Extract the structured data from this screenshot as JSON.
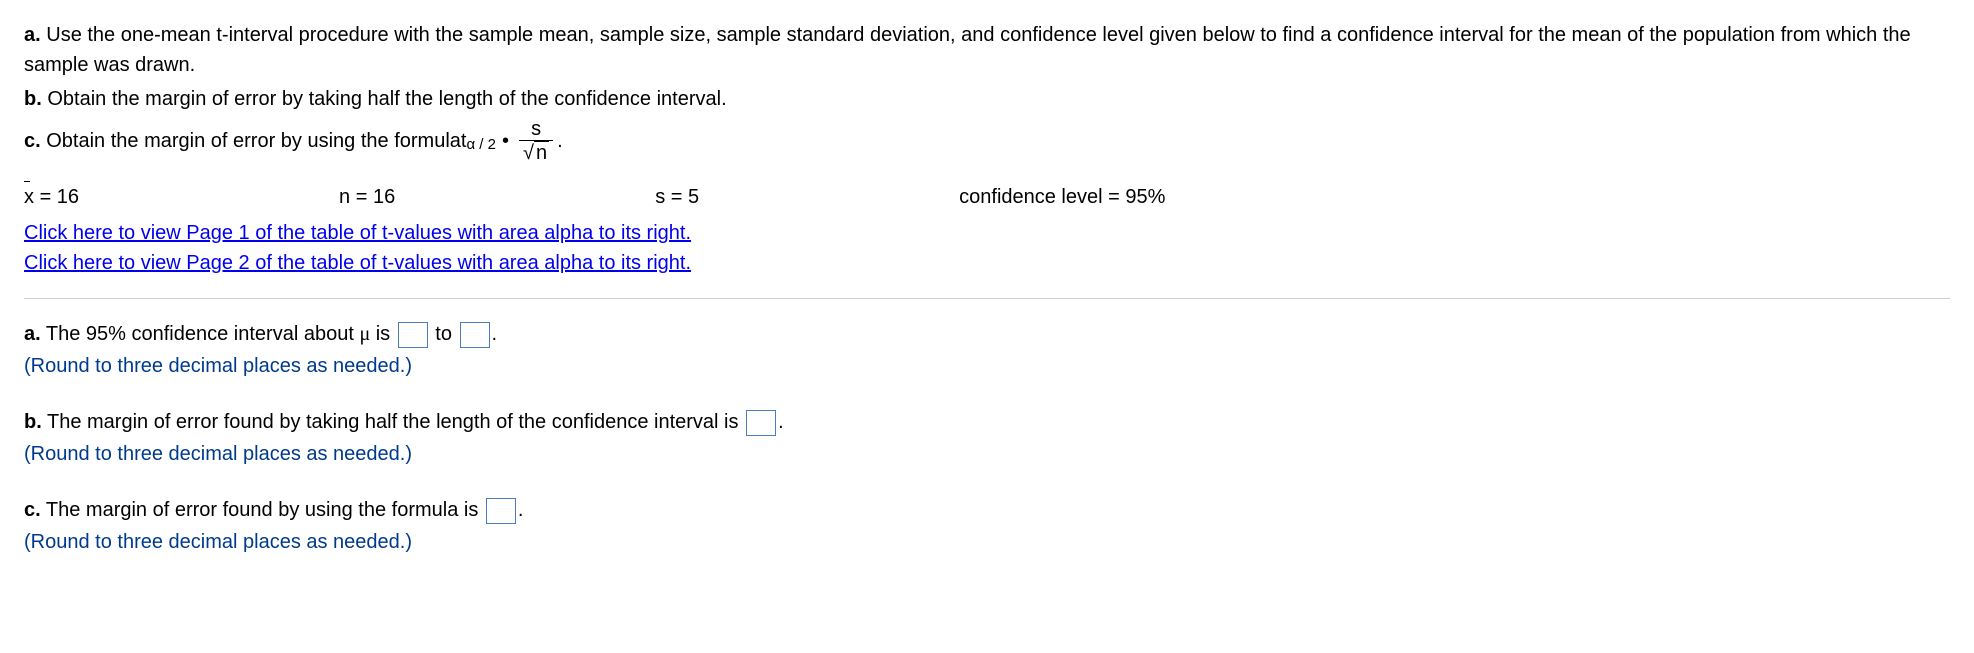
{
  "prompt": {
    "a": "Use the one-mean t-interval procedure with the sample mean, sample size, sample standard deviation, and confidence level given below to find a confidence interval for the mean of the population from which the sample was drawn.",
    "b": "Obtain the margin of error by taking half the length of the confidence interval.",
    "c_prefix": "Obtain the margin of error by using the formula ",
    "c_suffix": "."
  },
  "formula": {
    "t_label": "t",
    "sub_label": "α / 2",
    "dot": "•",
    "num": "s",
    "den_var": "n"
  },
  "given": {
    "xbar_label": "x",
    "xbar_value": "= 16",
    "n": "n = 16",
    "s": "s = 5",
    "conf": "confidence level = 95%"
  },
  "links": {
    "page1": "Click here to view Page 1 of the table of t-values with area alpha to its right.",
    "page2": "Click here to view Page 2 of the table of t-values with area alpha to its right."
  },
  "answers": {
    "a_prefix": "The 95% confidence interval about ",
    "a_mu": "μ",
    "a_is": " is ",
    "a_to": " to ",
    "a_period": ".",
    "b_text": "The margin of error found by taking half the length of the confidence interval is ",
    "c_text": "The margin of error found by using the formula is ",
    "round_hint": "(Round to three decimal places as needed.)"
  },
  "labels": {
    "a": "a.",
    "b": "b.",
    "c": "c."
  }
}
